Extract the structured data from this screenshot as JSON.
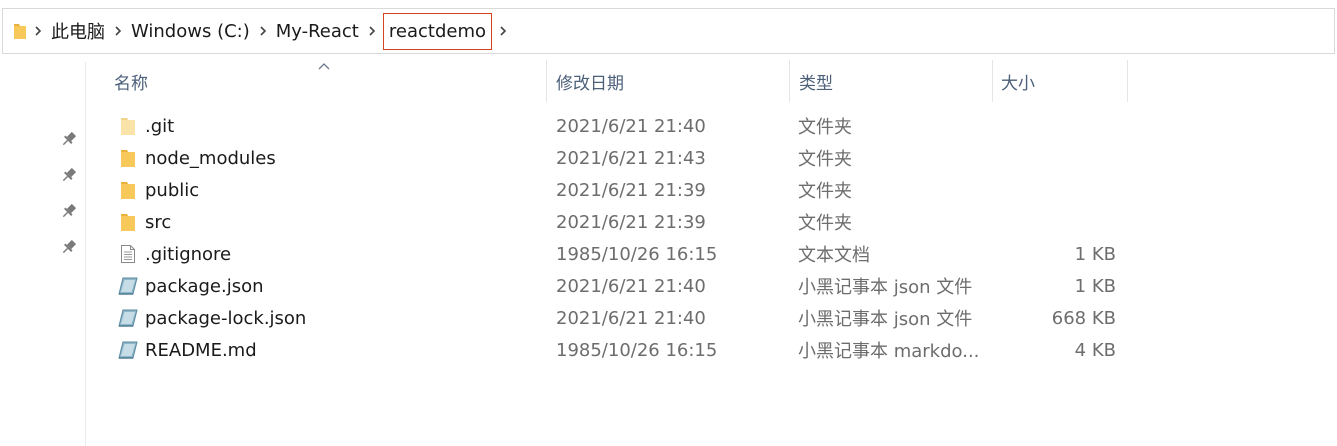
{
  "breadcrumb": {
    "items": [
      "此电脑",
      "Windows (C:)",
      "My-React",
      "reactdemo"
    ]
  },
  "columns": {
    "name": "名称",
    "date": "修改日期",
    "type": "类型",
    "size": "大小"
  },
  "colors": {
    "folder": "#f7c95b",
    "highlight_border": "#d8431f",
    "header_text": "#4c607a"
  },
  "files": [
    {
      "name": ".git",
      "date": "2021/6/21 21:40",
      "type": "文件夹",
      "size": "",
      "icon": "folder-faded-icon"
    },
    {
      "name": "node_modules",
      "date": "2021/6/21 21:43",
      "type": "文件夹",
      "size": "",
      "icon": "folder-icon"
    },
    {
      "name": "public",
      "date": "2021/6/21 21:39",
      "type": "文件夹",
      "size": "",
      "icon": "folder-icon"
    },
    {
      "name": "src",
      "date": "2021/6/21 21:39",
      "type": "文件夹",
      "size": "",
      "icon": "folder-icon"
    },
    {
      "name": ".gitignore",
      "date": "1985/10/26 16:15",
      "type": "文本文档",
      "size": "1 KB",
      "icon": "text-document-icon"
    },
    {
      "name": "package.json",
      "date": "2021/6/21 21:40",
      "type": "小黑记事本 json 文件",
      "size": "1 KB",
      "icon": "notepad-file-icon"
    },
    {
      "name": "package-lock.json",
      "date": "2021/6/21 21:40",
      "type": "小黑记事本 json 文件",
      "size": "668 KB",
      "icon": "notepad-file-icon"
    },
    {
      "name": "README.md",
      "date": "1985/10/26 16:15",
      "type": "小黑记事本 markdo...",
      "size": "4 KB",
      "icon": "notepad-file-icon"
    }
  ]
}
